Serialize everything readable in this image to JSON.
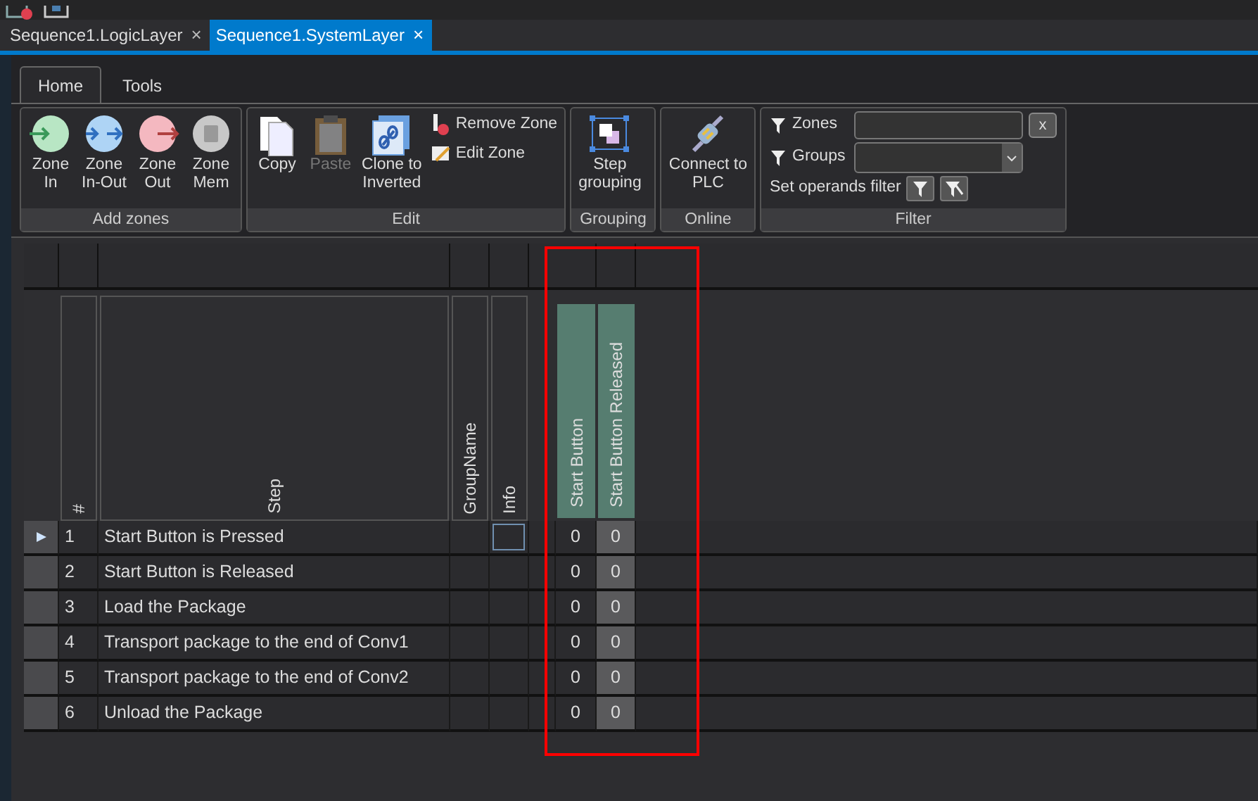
{
  "doc_tabs": [
    {
      "label": "Sequence1.LogicLayer",
      "close": "×",
      "selected": false
    },
    {
      "label": "Sequence1.SystemLayer",
      "close": "×",
      "selected": true
    }
  ],
  "ribbon_tabs": [
    {
      "label": "Home",
      "selected": true
    },
    {
      "label": "Tools",
      "selected": false
    }
  ],
  "ribbon_groups": [
    {
      "kind": "zones",
      "label": "Add zones",
      "buttons": [
        {
          "label": "Zone In",
          "disabled": false
        },
        {
          "label": "Zone In-Out",
          "disabled": false
        },
        {
          "label": "Zone Out",
          "disabled": false
        },
        {
          "label": "Zone Mem",
          "disabled": false
        }
      ]
    },
    {
      "kind": "edit",
      "label": "Edit",
      "buttons": [
        {
          "label": "Copy",
          "disabled": false
        },
        {
          "label": "Paste",
          "disabled": true
        },
        {
          "label": "Clone to Inverted",
          "disabled": false
        }
      ],
      "small_buttons": [
        {
          "label": "Remove Zone"
        },
        {
          "label": "Edit Zone"
        }
      ]
    },
    {
      "kind": "grouping",
      "label": "Grouping",
      "buttons": [
        {
          "label": "Step grouping",
          "disabled": false
        }
      ]
    },
    {
      "kind": "online",
      "label": "Online",
      "buttons": [
        {
          "label": "Connect to PLC",
          "disabled": false
        }
      ]
    },
    {
      "kind": "filter",
      "label": "Filter",
      "zones_label": "Zones",
      "clear": "x",
      "groups_label": "Groups",
      "operands_label": "Set operands filter"
    }
  ],
  "grid": {
    "columns": [
      "#",
      "Step",
      "GroupName",
      "Info"
    ],
    "operands": [
      {
        "label": "Start Button",
        "selected": false
      },
      {
        "label": "Start Button Released",
        "selected": true
      }
    ],
    "rows": [
      {
        "number": "1",
        "step": "Start Button is Pressed",
        "values": [
          "0",
          "0"
        ],
        "current": true
      },
      {
        "number": "2",
        "step": "Start Button is Released",
        "values": [
          "0",
          "0"
        ],
        "current": false
      },
      {
        "number": "3",
        "step": "Load the Package",
        "values": [
          "0",
          "0"
        ],
        "current": false
      },
      {
        "number": "4",
        "step": "Transport package to the end of Conv1",
        "values": [
          "0",
          "0"
        ],
        "current": false
      },
      {
        "number": "5",
        "step": "Transport package to the end of Conv2",
        "values": [
          "0",
          "0"
        ],
        "current": false
      },
      {
        "number": "6",
        "step": "Unload the Package",
        "values": [
          "0",
          "0"
        ],
        "current": false
      }
    ]
  }
}
